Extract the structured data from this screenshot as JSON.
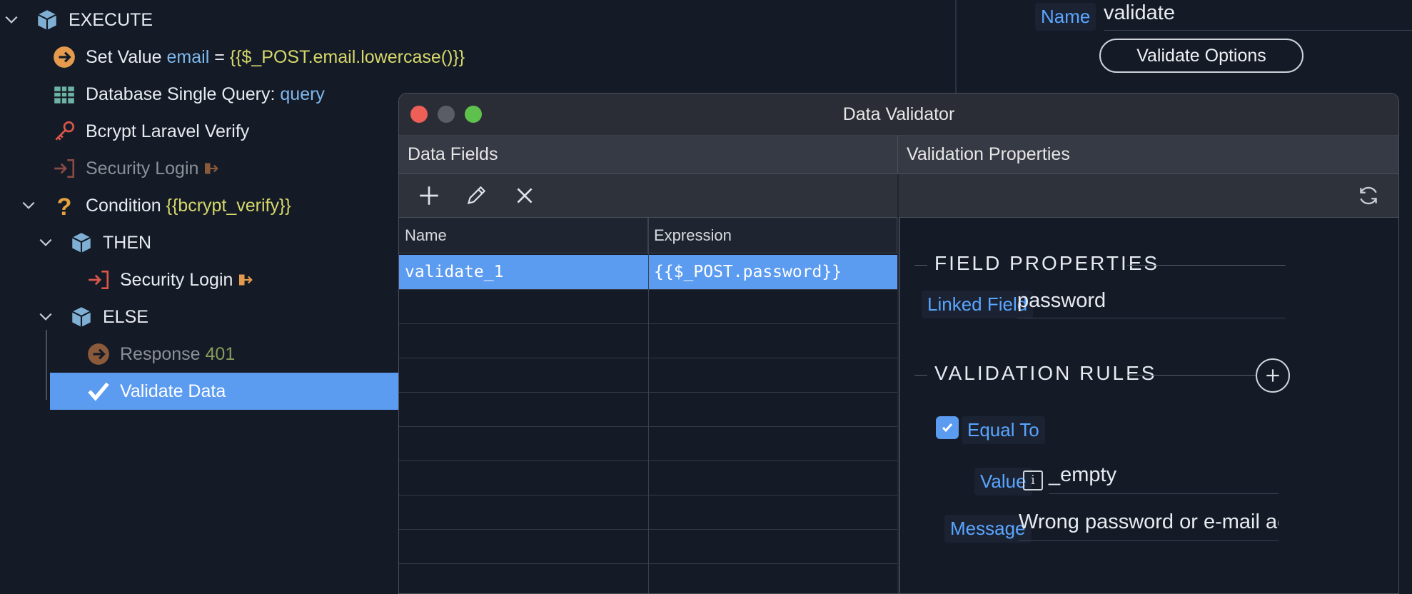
{
  "tree": {
    "execute": "EXECUTE",
    "set_value": {
      "label": "Set Value",
      "var": "email",
      "eq": "=",
      "expr": "{{$_POST.email.lowercase()}}"
    },
    "db_query": {
      "label": "Database Single Query:",
      "name": "query"
    },
    "bcrypt": {
      "label": "Bcrypt Laravel Verify"
    },
    "security_login_dim": {
      "label": "Security Login"
    },
    "condition": {
      "label": "Condition",
      "expr": "{{bcrypt_verify}}"
    },
    "then": "THEN",
    "security_login": {
      "label": "Security Login"
    },
    "else": "ELSE",
    "response": {
      "label": "Response",
      "code": "401"
    },
    "validate_data": {
      "label": "Validate Data"
    }
  },
  "props": {
    "name_label": "Name",
    "name_value": "validate",
    "validate_options": "Validate Options"
  },
  "dialog": {
    "title": "Data Validator",
    "left_header": "Data Fields",
    "right_header": "Validation Properties",
    "grid": {
      "columns": [
        "Name",
        "Expression"
      ],
      "rows": [
        {
          "name": "validate_1",
          "expression": "{{$_POST.password}}"
        }
      ]
    },
    "field_properties": {
      "section_title": "FIELD PROPERTIES",
      "linked_field_label": "Linked Field",
      "linked_field_value": "password"
    },
    "validation_rules": {
      "section_title": "VALIDATION RULES",
      "rule_label": "Equal To",
      "value_label": "Value",
      "value": "_empty",
      "message_label": "Message",
      "message": "Wrong password or e-mail addres"
    }
  },
  "colors": {
    "accent": "#5b9bf0",
    "link": "#5aa6ff",
    "background": "#141a26"
  }
}
